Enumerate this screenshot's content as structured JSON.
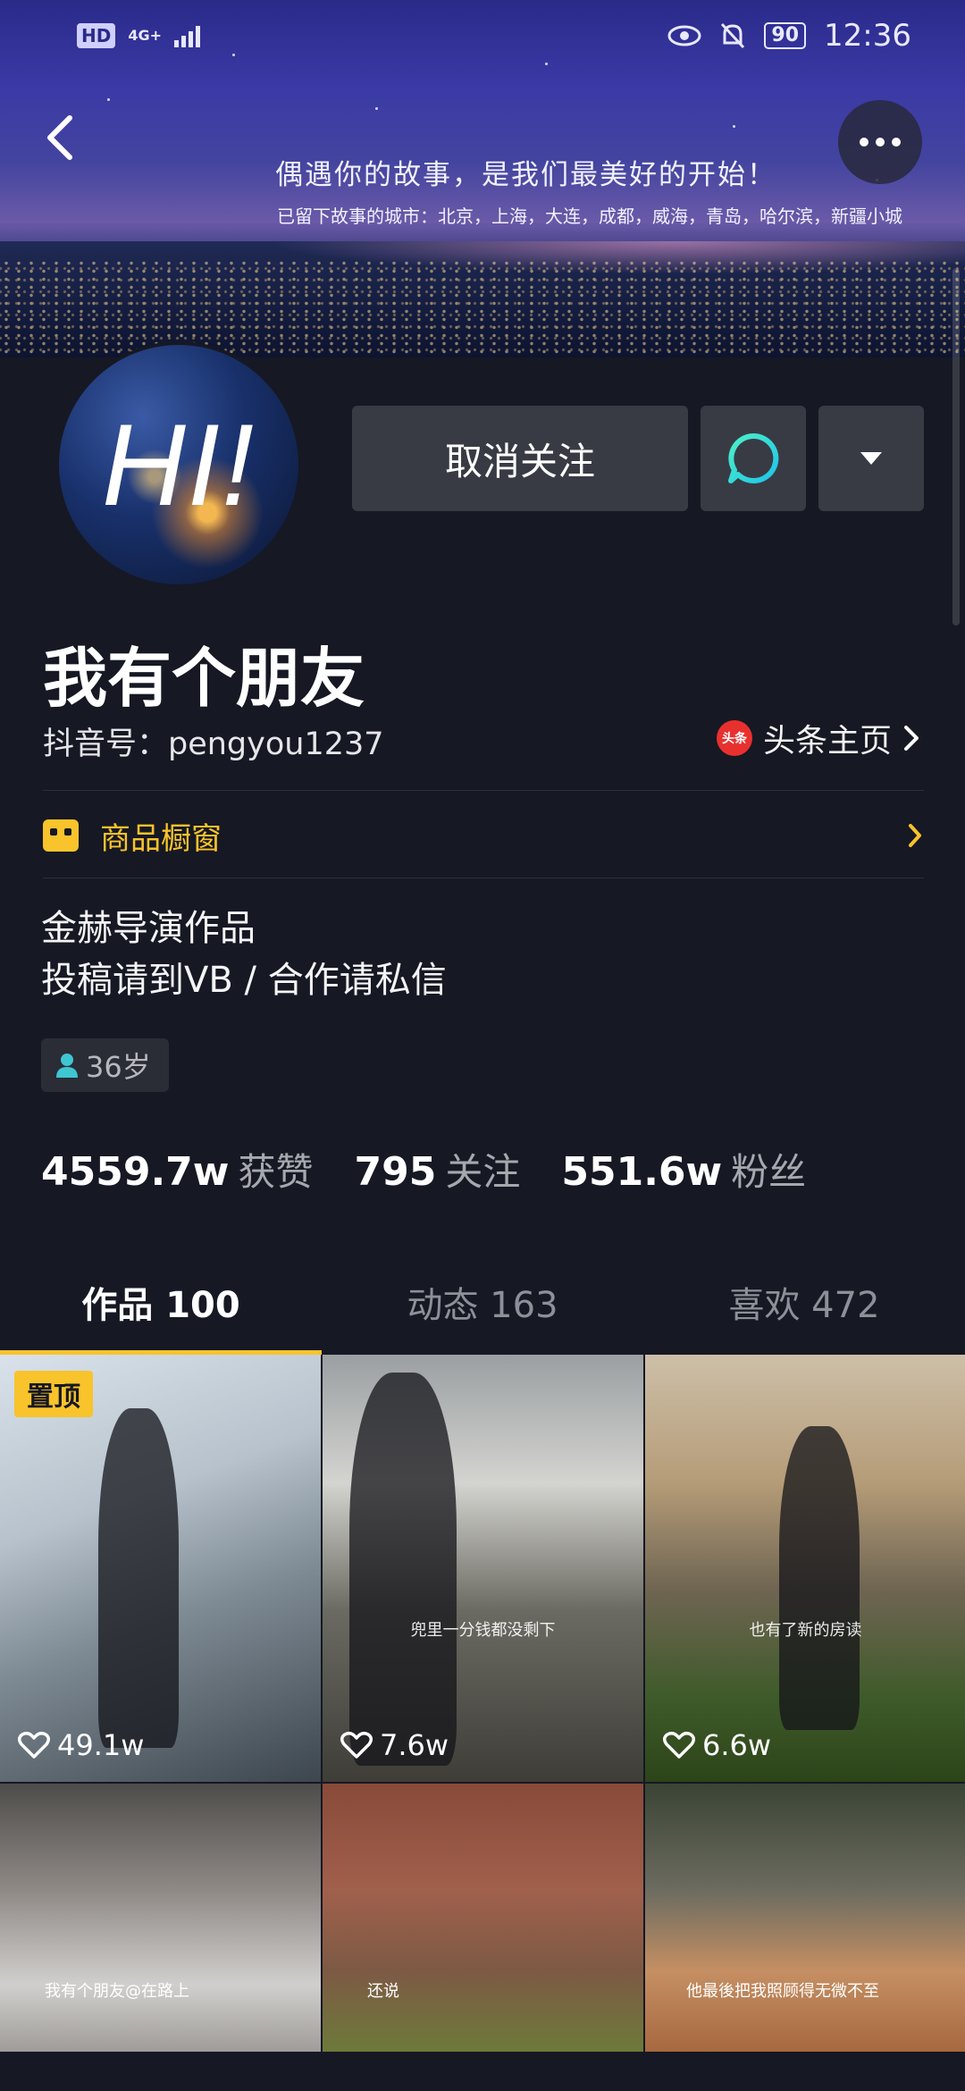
{
  "status_bar": {
    "hd": "HD",
    "network": "4G+",
    "battery": "90",
    "time": "12:36"
  },
  "banner": {
    "title": "偶遇你的故事，是我们最美好的开始！",
    "subtitle": "已留下故事的城市：北京，上海，大连，成都，威海，青岛，哈尔滨，新疆小城"
  },
  "profile": {
    "avatar_text": "HI!",
    "unfollow_label": "取消关注",
    "nickname": "我有个朋友",
    "douyin_id": "抖音号：pengyou1237",
    "toutiao_logo": "头条",
    "toutiao_label": "头条主页",
    "shop_label": "商品橱窗",
    "bio_line1": "金赫导演作品",
    "bio_line2": "投稿请到VB / 合作请私信",
    "age": "36岁"
  },
  "stats": [
    {
      "num": "4559.7w",
      "label": "获赞"
    },
    {
      "num": "795",
      "label": "关注"
    },
    {
      "num": "551.6w",
      "label": "粉丝"
    }
  ],
  "tabs": [
    {
      "label": "作品 100",
      "active": true
    },
    {
      "label": "动态 163",
      "active": false
    },
    {
      "label": "喜欢 472",
      "active": false
    }
  ],
  "videos": [
    {
      "likes": "49.1w",
      "pinned_label": "置顶",
      "caption": ""
    },
    {
      "likes": "7.6w",
      "caption": "兜里一分钱都没剩下"
    },
    {
      "likes": "6.6w",
      "caption": "也有了新的房读"
    },
    {
      "likes": "",
      "caption": "我有个朋友@在路上"
    },
    {
      "likes": "",
      "caption": "还说"
    },
    {
      "likes": "",
      "caption": "他最後把我照顾得无微不至"
    }
  ],
  "colors": {
    "background": "#161823",
    "accent": "#f8c32b",
    "button": "#393b44"
  }
}
